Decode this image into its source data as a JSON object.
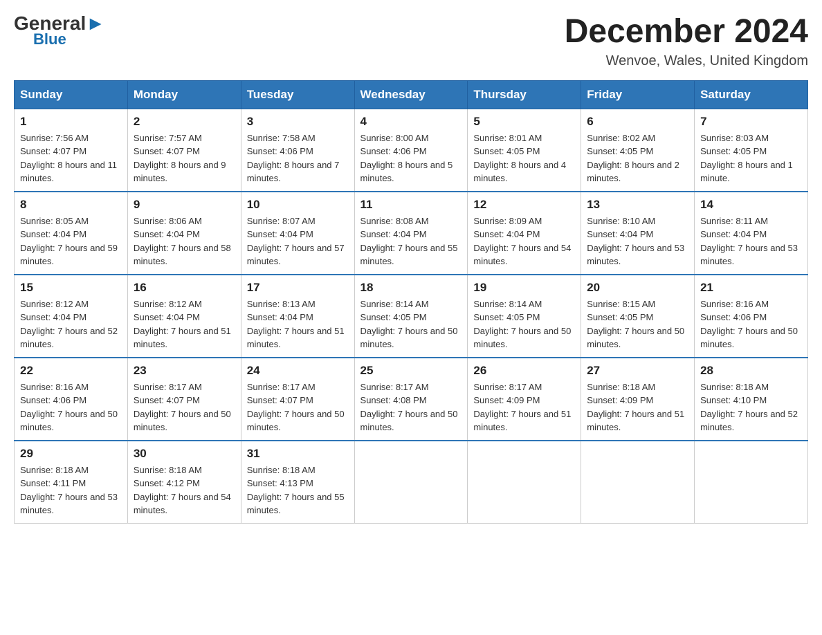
{
  "logo": {
    "general": "General",
    "blue": "Blue",
    "triangle": true
  },
  "title": "December 2024",
  "subtitle": "Wenvoe, Wales, United Kingdom",
  "days_of_week": [
    "Sunday",
    "Monday",
    "Tuesday",
    "Wednesday",
    "Thursday",
    "Friday",
    "Saturday"
  ],
  "weeks": [
    [
      {
        "day": "1",
        "sunrise": "7:56 AM",
        "sunset": "4:07 PM",
        "daylight": "8 hours and 11 minutes."
      },
      {
        "day": "2",
        "sunrise": "7:57 AM",
        "sunset": "4:07 PM",
        "daylight": "8 hours and 9 minutes."
      },
      {
        "day": "3",
        "sunrise": "7:58 AM",
        "sunset": "4:06 PM",
        "daylight": "8 hours and 7 minutes."
      },
      {
        "day": "4",
        "sunrise": "8:00 AM",
        "sunset": "4:06 PM",
        "daylight": "8 hours and 5 minutes."
      },
      {
        "day": "5",
        "sunrise": "8:01 AM",
        "sunset": "4:05 PM",
        "daylight": "8 hours and 4 minutes."
      },
      {
        "day": "6",
        "sunrise": "8:02 AM",
        "sunset": "4:05 PM",
        "daylight": "8 hours and 2 minutes."
      },
      {
        "day": "7",
        "sunrise": "8:03 AM",
        "sunset": "4:05 PM",
        "daylight": "8 hours and 1 minute."
      }
    ],
    [
      {
        "day": "8",
        "sunrise": "8:05 AM",
        "sunset": "4:04 PM",
        "daylight": "7 hours and 59 minutes."
      },
      {
        "day": "9",
        "sunrise": "8:06 AM",
        "sunset": "4:04 PM",
        "daylight": "7 hours and 58 minutes."
      },
      {
        "day": "10",
        "sunrise": "8:07 AM",
        "sunset": "4:04 PM",
        "daylight": "7 hours and 57 minutes."
      },
      {
        "day": "11",
        "sunrise": "8:08 AM",
        "sunset": "4:04 PM",
        "daylight": "7 hours and 55 minutes."
      },
      {
        "day": "12",
        "sunrise": "8:09 AM",
        "sunset": "4:04 PM",
        "daylight": "7 hours and 54 minutes."
      },
      {
        "day": "13",
        "sunrise": "8:10 AM",
        "sunset": "4:04 PM",
        "daylight": "7 hours and 53 minutes."
      },
      {
        "day": "14",
        "sunrise": "8:11 AM",
        "sunset": "4:04 PM",
        "daylight": "7 hours and 53 minutes."
      }
    ],
    [
      {
        "day": "15",
        "sunrise": "8:12 AM",
        "sunset": "4:04 PM",
        "daylight": "7 hours and 52 minutes."
      },
      {
        "day": "16",
        "sunrise": "8:12 AM",
        "sunset": "4:04 PM",
        "daylight": "7 hours and 51 minutes."
      },
      {
        "day": "17",
        "sunrise": "8:13 AM",
        "sunset": "4:04 PM",
        "daylight": "7 hours and 51 minutes."
      },
      {
        "day": "18",
        "sunrise": "8:14 AM",
        "sunset": "4:05 PM",
        "daylight": "7 hours and 50 minutes."
      },
      {
        "day": "19",
        "sunrise": "8:14 AM",
        "sunset": "4:05 PM",
        "daylight": "7 hours and 50 minutes."
      },
      {
        "day": "20",
        "sunrise": "8:15 AM",
        "sunset": "4:05 PM",
        "daylight": "7 hours and 50 minutes."
      },
      {
        "day": "21",
        "sunrise": "8:16 AM",
        "sunset": "4:06 PM",
        "daylight": "7 hours and 50 minutes."
      }
    ],
    [
      {
        "day": "22",
        "sunrise": "8:16 AM",
        "sunset": "4:06 PM",
        "daylight": "7 hours and 50 minutes."
      },
      {
        "day": "23",
        "sunrise": "8:17 AM",
        "sunset": "4:07 PM",
        "daylight": "7 hours and 50 minutes."
      },
      {
        "day": "24",
        "sunrise": "8:17 AM",
        "sunset": "4:07 PM",
        "daylight": "7 hours and 50 minutes."
      },
      {
        "day": "25",
        "sunrise": "8:17 AM",
        "sunset": "4:08 PM",
        "daylight": "7 hours and 50 minutes."
      },
      {
        "day": "26",
        "sunrise": "8:17 AM",
        "sunset": "4:09 PM",
        "daylight": "7 hours and 51 minutes."
      },
      {
        "day": "27",
        "sunrise": "8:18 AM",
        "sunset": "4:09 PM",
        "daylight": "7 hours and 51 minutes."
      },
      {
        "day": "28",
        "sunrise": "8:18 AM",
        "sunset": "4:10 PM",
        "daylight": "7 hours and 52 minutes."
      }
    ],
    [
      {
        "day": "29",
        "sunrise": "8:18 AM",
        "sunset": "4:11 PM",
        "daylight": "7 hours and 53 minutes."
      },
      {
        "day": "30",
        "sunrise": "8:18 AM",
        "sunset": "4:12 PM",
        "daylight": "7 hours and 54 minutes."
      },
      {
        "day": "31",
        "sunrise": "8:18 AM",
        "sunset": "4:13 PM",
        "daylight": "7 hours and 55 minutes."
      },
      null,
      null,
      null,
      null
    ]
  ],
  "labels": {
    "sunrise": "Sunrise:",
    "sunset": "Sunset:",
    "daylight": "Daylight:"
  }
}
